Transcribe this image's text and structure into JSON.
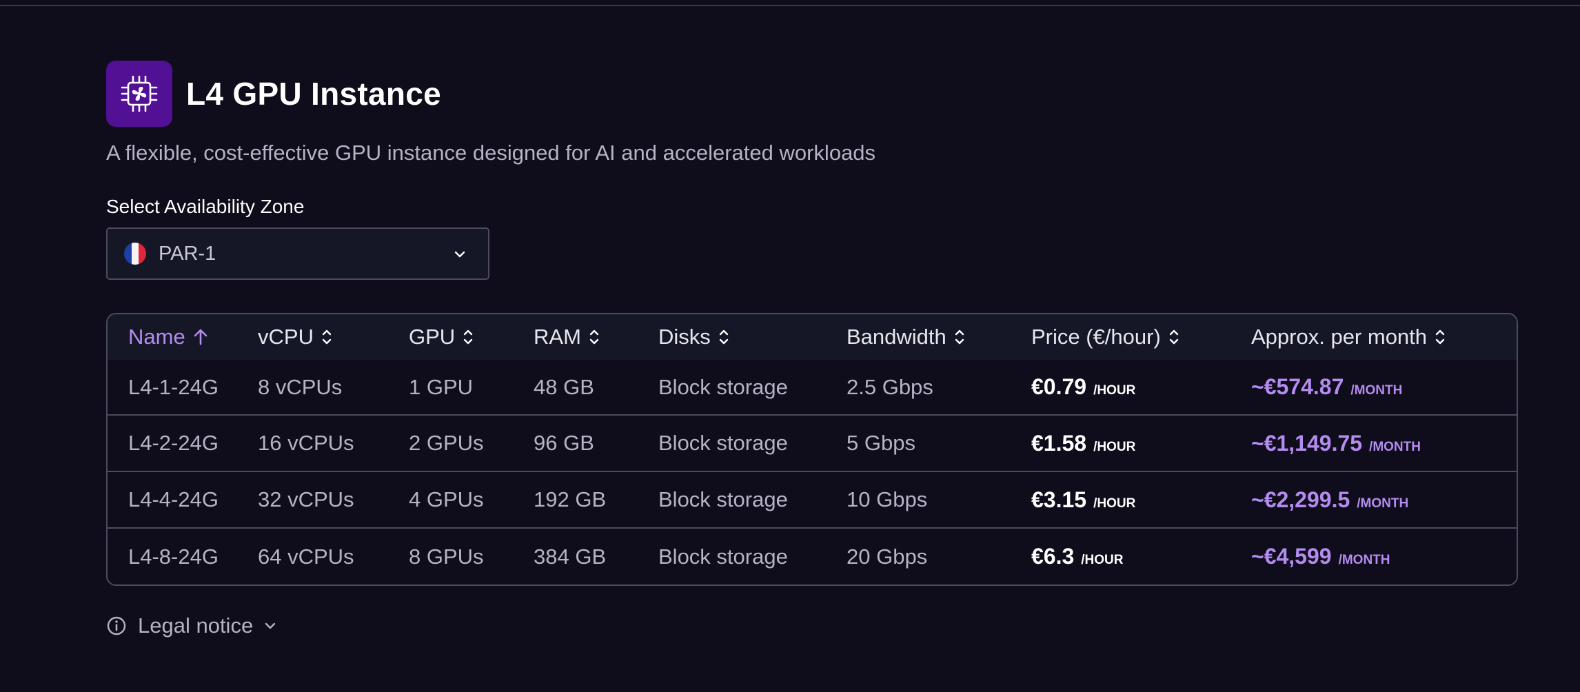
{
  "product": {
    "title": "L4 GPU Instance",
    "subtitle": "A flexible, cost-effective GPU instance designed for AI and accelerated workloads",
    "icon": "gpu-chip-icon",
    "accent_color": "#521094"
  },
  "zone": {
    "label": "Select Availability Zone",
    "selected": "PAR-1",
    "flag": "france-flag-icon"
  },
  "table": {
    "columns": [
      {
        "label": "Name",
        "sort": "asc"
      },
      {
        "label": "vCPU",
        "sort": "none"
      },
      {
        "label": "GPU",
        "sort": "none"
      },
      {
        "label": "RAM",
        "sort": "none"
      },
      {
        "label": "Disks",
        "sort": "none"
      },
      {
        "label": "Bandwidth",
        "sort": "none"
      },
      {
        "label": "Price (€/hour)",
        "sort": "none"
      },
      {
        "label": "Approx. per month",
        "sort": "none"
      }
    ],
    "rows": [
      {
        "name": "L4-1-24G",
        "vcpu": "8 vCPUs",
        "gpu": "1 GPU",
        "ram": "48 GB",
        "disks": "Block storage",
        "bandwidth": "2.5 Gbps",
        "price": "€0.79",
        "price_unit": "/HOUR",
        "month": "~€574.87",
        "month_unit": "/MONTH"
      },
      {
        "name": "L4-2-24G",
        "vcpu": "16 vCPUs",
        "gpu": "2 GPUs",
        "ram": "96 GB",
        "disks": "Block storage",
        "bandwidth": "5 Gbps",
        "price": "€1.58",
        "price_unit": "/HOUR",
        "month": "~€1,149.75",
        "month_unit": "/MONTH"
      },
      {
        "name": "L4-4-24G",
        "vcpu": "32 vCPUs",
        "gpu": "4 GPUs",
        "ram": "192 GB",
        "disks": "Block storage",
        "bandwidth": "10 Gbps",
        "price": "€3.15",
        "price_unit": "/HOUR",
        "month": "~€2,299.5",
        "month_unit": "/MONTH"
      },
      {
        "name": "L4-8-24G",
        "vcpu": "64 vCPUs",
        "gpu": "8 GPUs",
        "ram": "384 GB",
        "disks": "Block storage",
        "bandwidth": "20 Gbps",
        "price": "€6.3",
        "price_unit": "/HOUR",
        "month": "~€4,599",
        "month_unit": "/MONTH"
      }
    ]
  },
  "legal": {
    "label": "Legal notice",
    "icon": "info-icon"
  },
  "colors": {
    "background": "#0f0c1b",
    "header_row": "#151726",
    "purple_text": "#b48cf0",
    "border": "#4b4a5e"
  }
}
